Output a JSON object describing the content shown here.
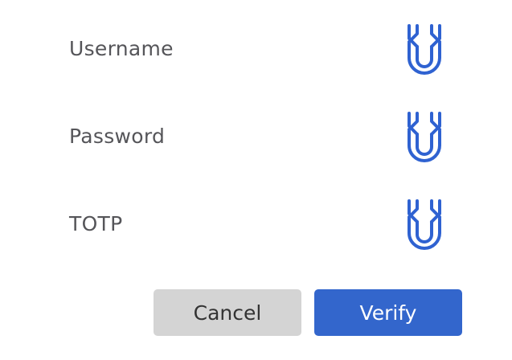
{
  "form": {
    "fields": [
      {
        "label": "Username",
        "icon": "password-manager-icon"
      },
      {
        "label": "Password",
        "icon": "password-manager-icon"
      },
      {
        "label": "TOTP",
        "icon": "password-manager-icon"
      }
    ]
  },
  "actions": {
    "cancel_label": "Cancel",
    "verify_label": "Verify"
  },
  "colors": {
    "accent": "#3366cc",
    "icon": "#2f62d1",
    "label": "#555559",
    "cancel_bg": "#d4d4d4",
    "cancel_text": "#333333",
    "verify_text": "#ffffff"
  }
}
